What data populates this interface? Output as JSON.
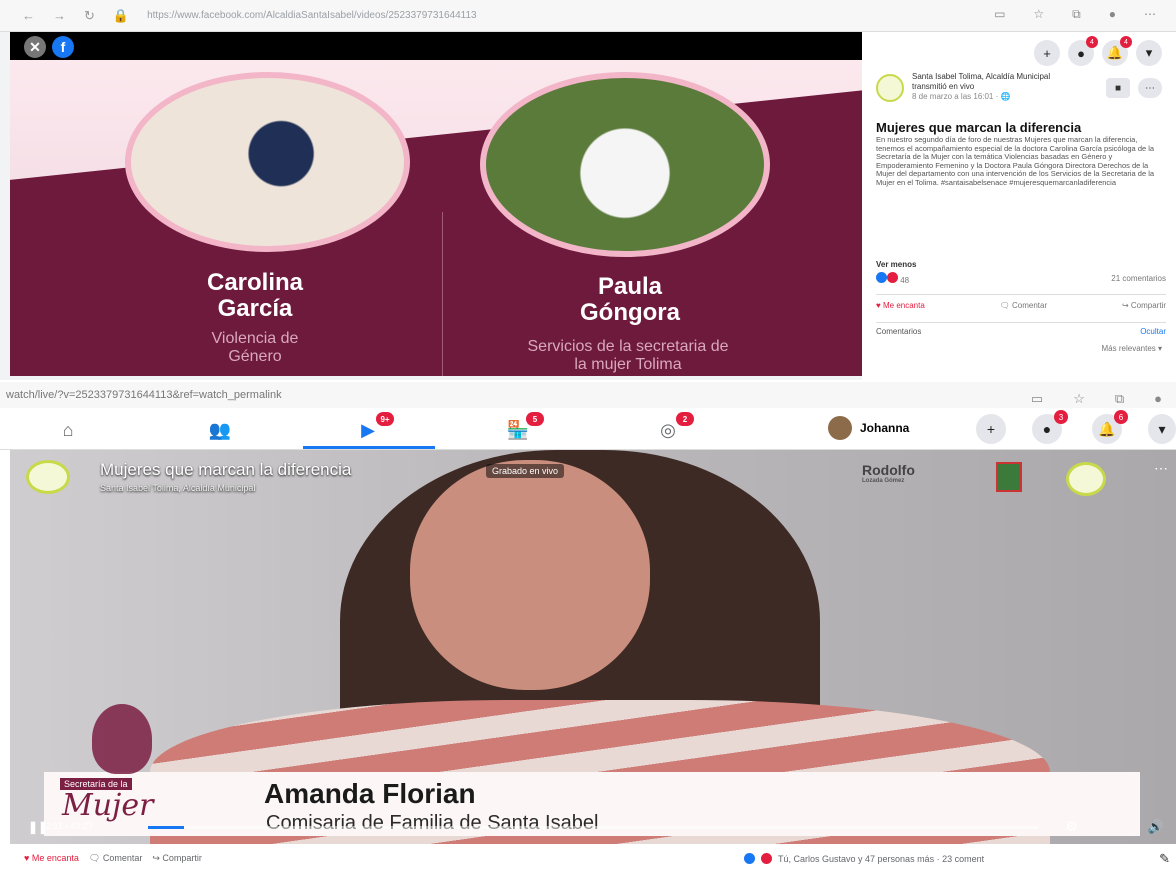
{
  "top_browser": {
    "url": "https://www.facebook.com/AlcaldiaSantaIsabel/videos/2523379731644113",
    "video": {
      "speaker1_first": "Carolina",
      "speaker1_last": "García",
      "speaker1_topic_line1": "Violencia de",
      "speaker1_topic_line2": "Género",
      "speaker2_first": "Paula",
      "speaker2_last": "Góngora",
      "speaker2_topic_line1": "Servicios de la secretaria de",
      "speaker2_topic_line2": "la mujer Tolima"
    },
    "sidebar": {
      "badge_messenger": "4",
      "badge_notifications": "4",
      "page_name": "Santa Isabel Tolima, Alcaldía Municipal transmitió en vivo",
      "post_date": "8 de marzo a las 16:01 · 🌐",
      "post_title": "Mujeres que marcan la diferencia",
      "post_body": "En nuestro segundo día de foro de nuestras Mujeres que marcan la diferencia, tenemos el acompañamiento especial de la doctora Carolina García psicóloga de la Secretaría de la Mujer con la temática Violencias basadas en Género y Empoderamiento Femenino y la Doctora Paula Góngora Directora Derechos de la Mujer del departamento con una intervención de los Servicios de la Secretaria de la Mujer en el Tolima. #santaisabelsenace #mujeresquemarcanladiferencia",
      "see_less": "Ver menos",
      "reactions_count": "48",
      "comments_count": "21 comentarios",
      "like_label": "Me encanta",
      "comment_label": "Comentar",
      "share_label": "Compartir",
      "comments_heading": "Comentarios",
      "comments_action": "Ocultar",
      "sort_label": "Más relevantes ▾"
    }
  },
  "bottom_browser": {
    "url": "watch/live/?v=2523379731644113&ref=watch_permalink",
    "nav": {
      "watch_badge": "9+",
      "marketplace_badge": "5",
      "groups_badge": "2",
      "user_name": "Johanna",
      "messenger_badge": "3",
      "notifications_badge": "6"
    },
    "live": {
      "title": "Mujeres que marcan la diferencia",
      "live_tag": "Grabado en vivo",
      "page_name": "Santa Isabel Tolima, Alcaldía Municipal",
      "right_logo": "Rodolfo",
      "right_logo_sub": "Lozada Gómez",
      "lower_third_name": "Amanda Florian",
      "lower_third_role": "Comisaria de Familia de Santa Isabel",
      "secretaria_label": "Secretaría de la",
      "mujer_label": "Mujer",
      "time": "2:11 / 43:27",
      "progress": 0.04
    },
    "actions": {
      "like": "Me encanta",
      "comment": "Comentar",
      "share": "Compartir",
      "summary": "Tú, Carlos Gustavo y 47 personas más · 23 coment"
    }
  }
}
